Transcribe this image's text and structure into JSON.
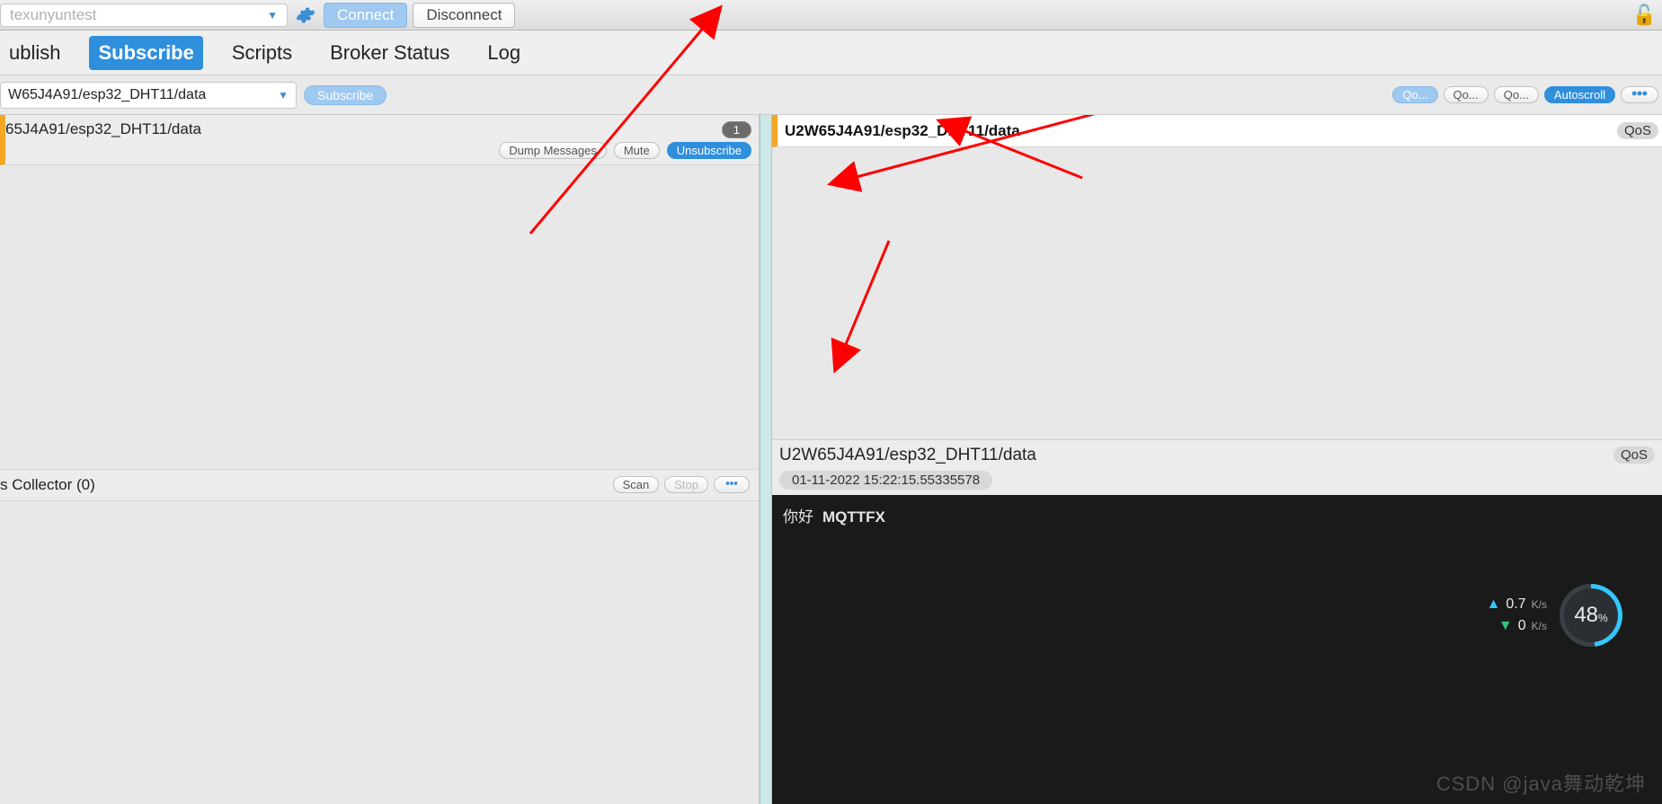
{
  "topbar": {
    "connection_name": "texunyuntest",
    "connect_label": "Connect",
    "disconnect_label": "Disconnect"
  },
  "tabs": {
    "publish": "ublish",
    "subscribe": "Subscribe",
    "scripts": "Scripts",
    "broker_status": "Broker Status",
    "log": "Log"
  },
  "subscribe_row": {
    "topic_input": "W65J4A91/esp32_DHT11/data",
    "subscribe_label": "Subscribe",
    "qos_btn1": "Qo...",
    "qos_btn2": "Qo...",
    "qos_btn3": "Qo...",
    "autoscroll_label": "Autoscroll"
  },
  "left": {
    "topic_text": "65J4A91/esp32_DHT11/data",
    "count": "1",
    "dump_label": "Dump Messages",
    "mute_label": "Mute",
    "unsubscribe_label": "Unsubscribe",
    "collector_label": "s Collector (0)",
    "scan_label": "Scan",
    "stop_label": "Stop"
  },
  "right": {
    "msg_topic": "U2W65J4A91/esp32_DHT11/data",
    "qos_label_short": "QoS",
    "detail_topic": "U2W65J4A91/esp32_DHT11/data",
    "timestamp": "01-11-2022  15:22:15.55335578",
    "payload_prefix": "你好",
    "payload_bold": "MQTTFX"
  },
  "overlay": {
    "up_speed": "0.7",
    "down_speed": "0",
    "unit": "K/s",
    "percent": "48"
  },
  "watermark": "CSDN @java舞动乾坤"
}
